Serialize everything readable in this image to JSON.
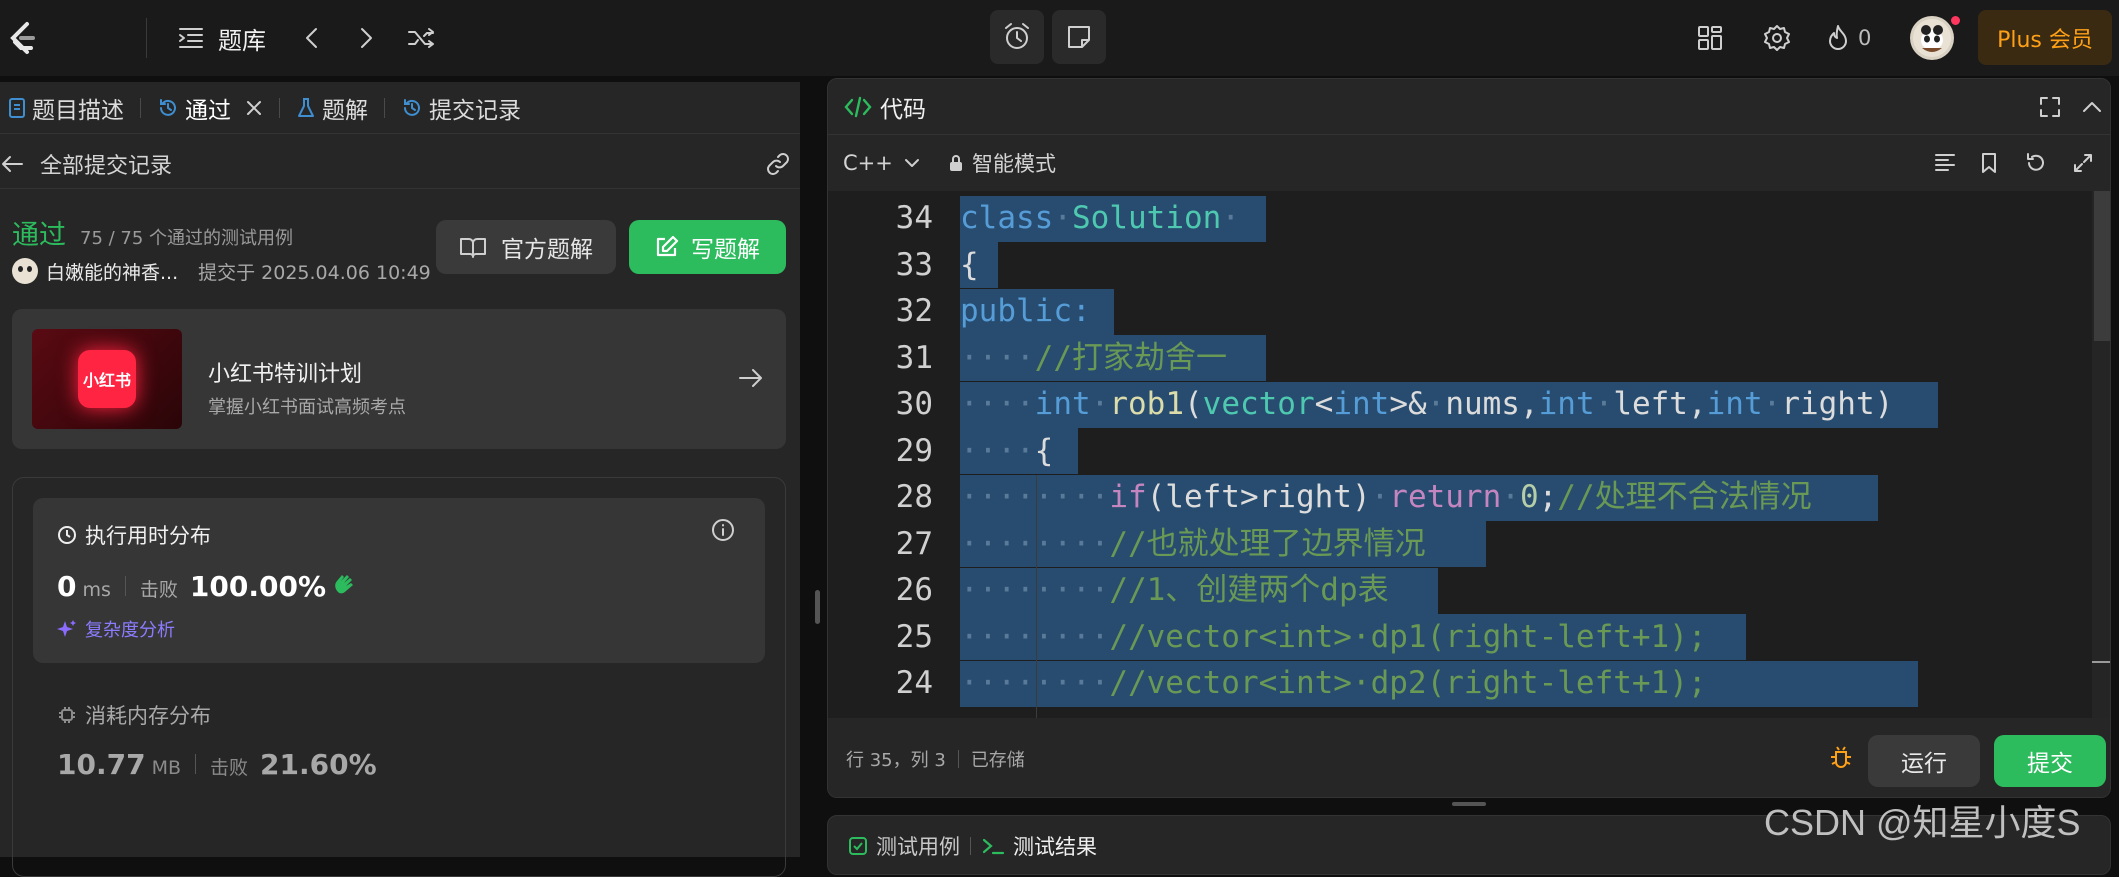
{
  "topbar": {
    "problem_bank_label": "题库",
    "streak_count": "0",
    "plus_label": "Plus 会员"
  },
  "left_panel": {
    "tabs": [
      {
        "label": "题目描述"
      },
      {
        "label": "通过"
      },
      {
        "label": "题解"
      },
      {
        "label": "提交记录"
      }
    ],
    "back_label": "全部提交记录",
    "status": "通过",
    "test_summary": "75 / 75 个通过的测试用例",
    "username": "白嫩能的神香...",
    "submitted_at": "提交于 2025.04.06 10:49",
    "official_solution_label": "官方题解",
    "write_solution_label": "写题解",
    "promo": {
      "logo_text": "小红书",
      "title": "小红书特训计划",
      "subtitle": "掌握小红书面试高频考点"
    },
    "runtime": {
      "title": "执行用时分布",
      "value": "0",
      "unit": "ms",
      "beats_label": "击败",
      "beats_value": "100.00%",
      "complexity_label": "复杂度分析"
    },
    "memory": {
      "title": "消耗内存分布",
      "value": "10.77",
      "unit": "MB",
      "beats_label": "击败",
      "beats_value": "21.60%"
    }
  },
  "editor": {
    "title": "代码",
    "language": "C++",
    "mode": "智能模式",
    "status_position": "行 35，列 3",
    "status_saved": "已存储",
    "run_label": "运行",
    "submit_label": "提交",
    "line_numbers": [
      "34",
      "33",
      "32",
      "31",
      "30",
      "29",
      "28",
      "27",
      "26",
      "25",
      "24"
    ]
  },
  "bottom_panel": {
    "tabs": [
      {
        "label": "测试用例"
      },
      {
        "label": "测试结果"
      }
    ]
  },
  "watermark": "CSDN @知星小度S",
  "colors": {
    "accent_green": "#2cbb5d",
    "plus_gold": "#ffa116",
    "selection_blue": "#274c70"
  }
}
